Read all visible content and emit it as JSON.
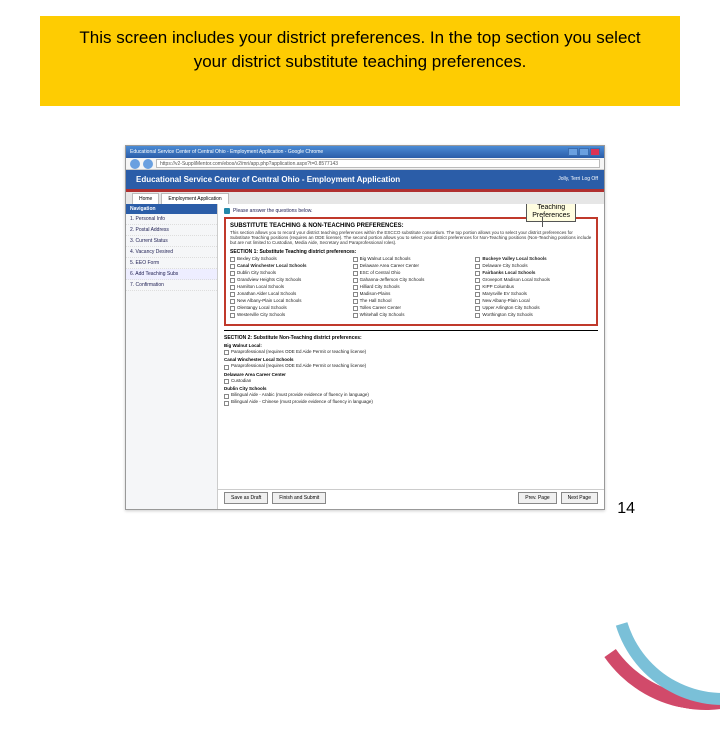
{
  "banner": {
    "text": "This screen includes your district preferences. In the top section you select your district substitute teaching preferences."
  },
  "window": {
    "title": "Educational Service Center of Central Ohio - Employment Application - Google Chrome",
    "url": "https://v2-SuppliMentor.com/ebos/v2/mri/app.php?application.aspx?t=0.8577143"
  },
  "header": {
    "title": "Educational Service Center of Central Ohio - Employment Application",
    "user": "Jolly, Terri",
    "logout": "Log Off"
  },
  "tabs": {
    "home": "Home",
    "app": "Employment Application"
  },
  "nav": {
    "title": "Navigation",
    "items": [
      "1. Personal Info",
      "2. Postal Address",
      "3. Current Status",
      "4. Vacancy Desired",
      "5. EEO Form",
      "6. Add Teaching Subs",
      "7. Confirmation"
    ]
  },
  "alert": "Please answer the questions below.",
  "callout": {
    "l1": "Teaching",
    "l2": "Preferences"
  },
  "section_title": "SUBSTITUTE TEACHING & NON-TEACHING PREFERENCES:",
  "section_desc": "This section allows you to record your district teaching preferences within the ESCCO substitute consortium. The top portion allows you to select your district preferences for Substitute Teaching positions (requires an ODE license). The second portion allows you to select your district preferences for Non-Teaching positions (Non-Teaching positions include but are not limited to Custodian, Media Aide, Secretary and Paraprofessional roles).",
  "sec1_label": "SECTION 1: Substitute Teaching district preferences:",
  "cols": {
    "c1": [
      {
        "t": "Bexley City Schools",
        "b": false
      },
      {
        "t": "Canal Winchester Local Schools",
        "b": true
      },
      {
        "t": "Dublin City Schools",
        "b": false
      },
      {
        "t": "Grandview Heights City Schools",
        "b": false
      },
      {
        "t": "Hamilton Local Schools",
        "b": false
      },
      {
        "t": "Jonathan Alder Local Schools",
        "b": false
      },
      {
        "t": "New Albany-Plain Local Schools",
        "b": false
      },
      {
        "t": "Olentangy Local Schools",
        "b": false
      },
      {
        "t": "Westerville City Schools",
        "b": false
      }
    ],
    "c2": [
      {
        "t": "Big Walnut Local Schools",
        "b": false
      },
      {
        "t": "Delaware Area Career Center",
        "b": false
      },
      {
        "t": "ESC of Central Ohio",
        "b": false
      },
      {
        "t": "Gahanna-Jefferson City Schools",
        "b": false
      },
      {
        "t": "Hilliard City Schools",
        "b": false
      },
      {
        "t": "Madison-Plains",
        "b": false
      },
      {
        "t": "The Hall School",
        "b": false
      },
      {
        "t": "Tolles Career Center",
        "b": false
      },
      {
        "t": "Whitehall City Schools",
        "b": false
      }
    ],
    "c3": [
      {
        "t": "Buckeye Valley Local Schools",
        "b": true
      },
      {
        "t": "Delaware City Schools",
        "b": false
      },
      {
        "t": "Fairbanks Local Schools",
        "b": true
      },
      {
        "t": "Groveport Madison Local Schools",
        "b": false
      },
      {
        "t": "KIPP Columbus",
        "b": false
      },
      {
        "t": "Marysville EV Schools",
        "b": false
      },
      {
        "t": "New Albany-Plain Local",
        "b": false
      },
      {
        "t": "Upper Arlington City Schools",
        "b": false
      },
      {
        "t": "Worthington City Schools",
        "b": false
      }
    ]
  },
  "sec2_label": "SECTION 2: Substitute Non-Teaching district preferences:",
  "sec2": {
    "big_walnut": "Big Walnut Local:",
    "bw_item": "Paraprofessional (requires ODE Ed Aide Permit or teaching license)",
    "canal": "Canal Winchester Local Schools",
    "cw_item": "Paraprofessional (requires ODE Ed Aide Permit or teaching license)",
    "del": "Delaware Area Career Center",
    "del_item": "Custodian",
    "dublin": "Dublin City Schools",
    "d1": "Bilingual Aide - Arabic (must provide evidence of fluency in language)",
    "d2": "Bilingual Aide - Chinese (must provide evidence of fluency in language)"
  },
  "buttons": {
    "draft": "Save as Draft",
    "finish": "Finish and Submit",
    "prev": "Prev. Page",
    "next": "Next Page"
  },
  "page_number": "14"
}
